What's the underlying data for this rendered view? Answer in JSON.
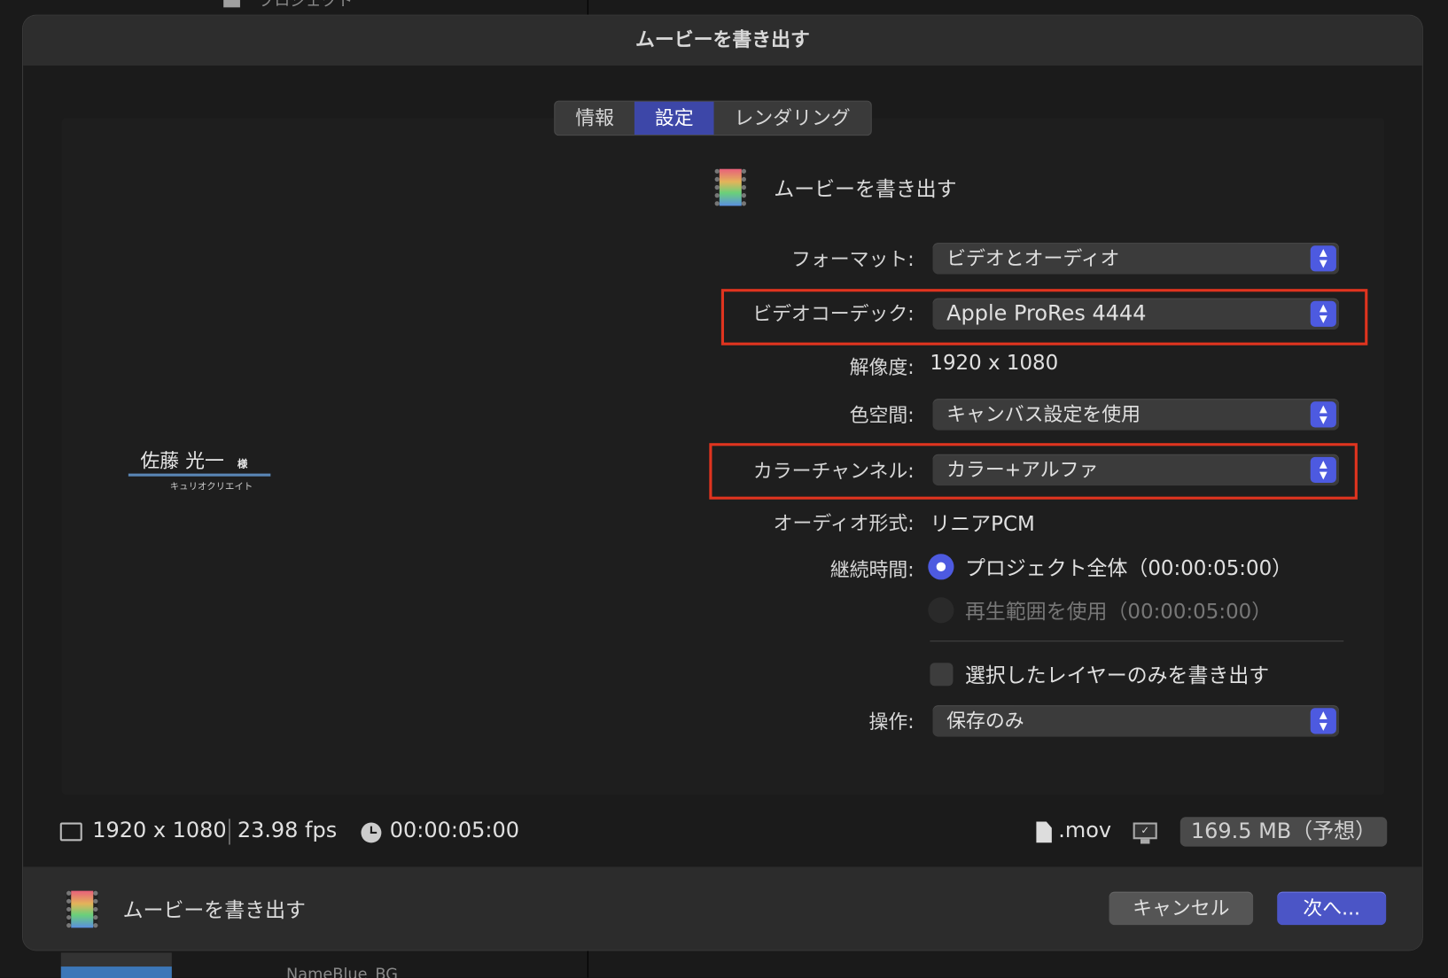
{
  "background": {
    "top_item": "プロジェクト",
    "bottom_item": "NameBlue_BG"
  },
  "dialog": {
    "title": "ムービーを書き出す",
    "tabs": [
      {
        "label": "情報"
      },
      {
        "label": "設定",
        "selected": true
      },
      {
        "label": "レンダリング"
      }
    ],
    "preview": {
      "name": "佐藤 光一",
      "honorific": "様",
      "company": "キュリオクリエイト"
    },
    "header": {
      "label": "ムービーを書き出す"
    },
    "settings": {
      "format": {
        "label": "フォーマット:",
        "value": "ビデオとオーディオ"
      },
      "codec": {
        "label": "ビデオコーデック:",
        "value": "Apple ProRes 4444"
      },
      "resolution": {
        "label": "解像度:",
        "value": "1920 x 1080"
      },
      "color_space": {
        "label": "色空間:",
        "value": "キャンバス設定を使用"
      },
      "color_channels": {
        "label": "カラーチャンネル:",
        "value": "カラー+アルファ"
      },
      "audio_format": {
        "label": "オーディオ形式:",
        "value": "リニアPCM"
      },
      "duration": {
        "label": "継続時間:",
        "options": [
          {
            "label": "プロジェクト全体（00:00:05:00）",
            "selected": true
          },
          {
            "label": "再生範囲を使用（00:00:05:00）",
            "selected": false,
            "disabled": true
          }
        ]
      },
      "selected_layers_only": {
        "label": "選択したレイヤーのみを書き出す",
        "checked": false
      },
      "action": {
        "label": "操作:",
        "value": "保存のみ"
      }
    },
    "summary": {
      "resolution": "1920 x 1080",
      "fps": "23.98 fps",
      "duration": "00:00:05:00",
      "extension": ".mov",
      "size": "169.5 MB（予想）"
    },
    "footer": {
      "label": "ムービーを書き出す",
      "cancel": "キャンセル",
      "next": "次へ..."
    },
    "colors": {
      "accent": "#4d5ae0",
      "highlight": "#e0341f"
    }
  }
}
